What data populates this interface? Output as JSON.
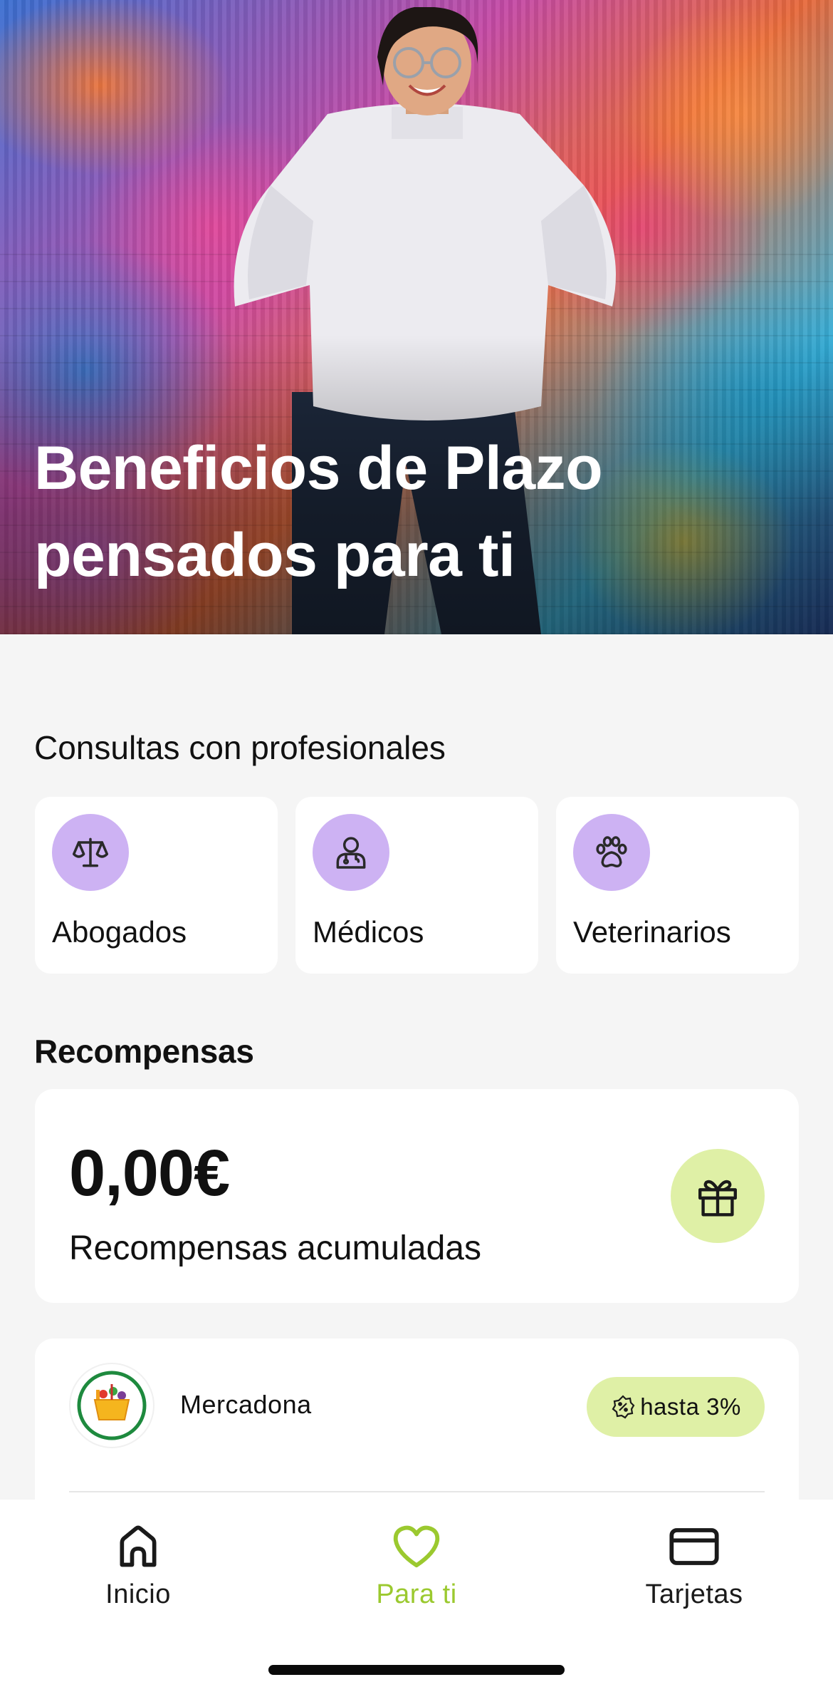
{
  "hero": {
    "title_line1": "Beneficios de Plazo",
    "title_line2": "pensados para ti"
  },
  "consultas": {
    "title": "Consultas con profesionales",
    "items": [
      {
        "label": "Abogados",
        "icon": "scales-icon"
      },
      {
        "label": "Médicos",
        "icon": "doctor-icon"
      },
      {
        "label": "Veterinarios",
        "icon": "paw-icon"
      }
    ]
  },
  "recompensas": {
    "title": "Recompensas",
    "amount": "0,00€",
    "label": "Recompensas acumuladas",
    "icon": "gift-icon"
  },
  "merchants": [
    {
      "name": "Mercadona",
      "badge": "hasta 3%",
      "logo_icon": "basket-icon",
      "badge_icon": "discount-icon"
    }
  ],
  "nav": {
    "items": [
      {
        "label": "Inicio",
        "icon": "home-icon",
        "active": false
      },
      {
        "label": "Para ti",
        "icon": "heart-icon",
        "active": true
      },
      {
        "label": "Tarjetas",
        "icon": "card-icon",
        "active": false
      }
    ]
  },
  "colors": {
    "accent_purple": "#cdb2f3",
    "accent_lime": "#dff0a6",
    "active_nav": "#9bc92f",
    "background": "#f5f5f5"
  }
}
